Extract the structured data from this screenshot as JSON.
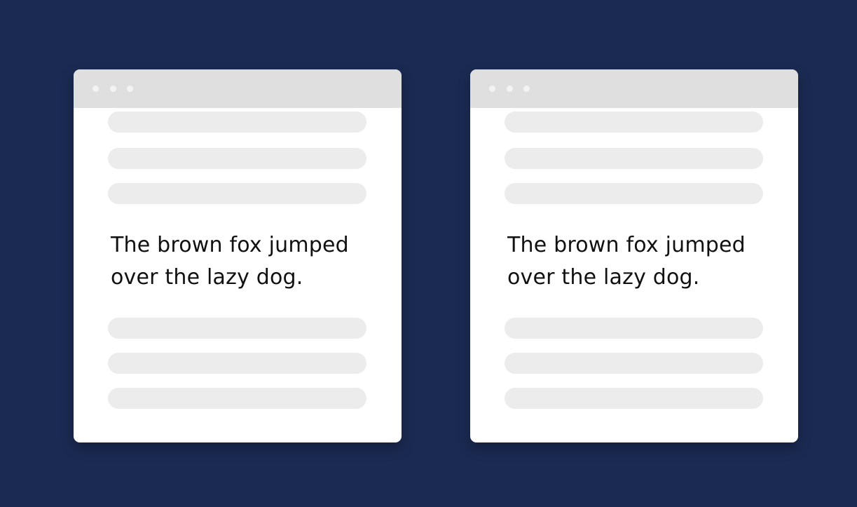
{
  "colors": {
    "background": "#1b2a52",
    "window": "#ffffff",
    "titlebar": "#dfdfdf",
    "titlebar_dots": "#f3f3f3",
    "placeholder_bar": "#ececec",
    "text": "#111111"
  },
  "windows": [
    {
      "headline_line1": "The brown fox jumped",
      "headline_line2": "over the lazy dog.",
      "placeholder_lines_above": 3,
      "placeholder_lines_below": 3
    },
    {
      "headline_line1": "The brown fox jumped",
      "headline_line2": "over the lazy dog.",
      "placeholder_lines_above": 3,
      "placeholder_lines_below": 3
    }
  ]
}
